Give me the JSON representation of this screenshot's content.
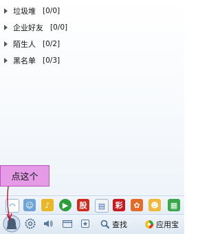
{
  "groups": [
    {
      "name": "垃圾堆",
      "count": "[0/0]"
    },
    {
      "name": "企业好友",
      "count": "[0/0]"
    },
    {
      "name": "陌生人",
      "count": "[0/2]"
    },
    {
      "name": "黑名单",
      "count": "[0/3]"
    }
  ],
  "callout": {
    "text": "点这个"
  },
  "toolbar": {
    "apps": [
      {
        "icon": "qzone-icon",
        "glyph": "◠"
      },
      {
        "icon": "friends-icon",
        "glyph": "☺"
      },
      {
        "icon": "music-icon",
        "glyph": "♪"
      },
      {
        "icon": "video-icon",
        "glyph": "▶"
      },
      {
        "icon": "stock-icon",
        "glyph": "股"
      },
      {
        "icon": "news-icon",
        "glyph": "▤"
      },
      {
        "icon": "game-icon",
        "glyph": "彩"
      },
      {
        "icon": "pet-icon",
        "glyph": "✿"
      },
      {
        "icon": "avatar-game-icon",
        "glyph": "☻"
      },
      {
        "icon": "app-grid-icon",
        "glyph": "▦"
      }
    ],
    "search_label": "查找",
    "appstore_label": "应用宝"
  },
  "colors": {
    "callout_bg": "#e59be6",
    "arrow": "#c0102a"
  }
}
